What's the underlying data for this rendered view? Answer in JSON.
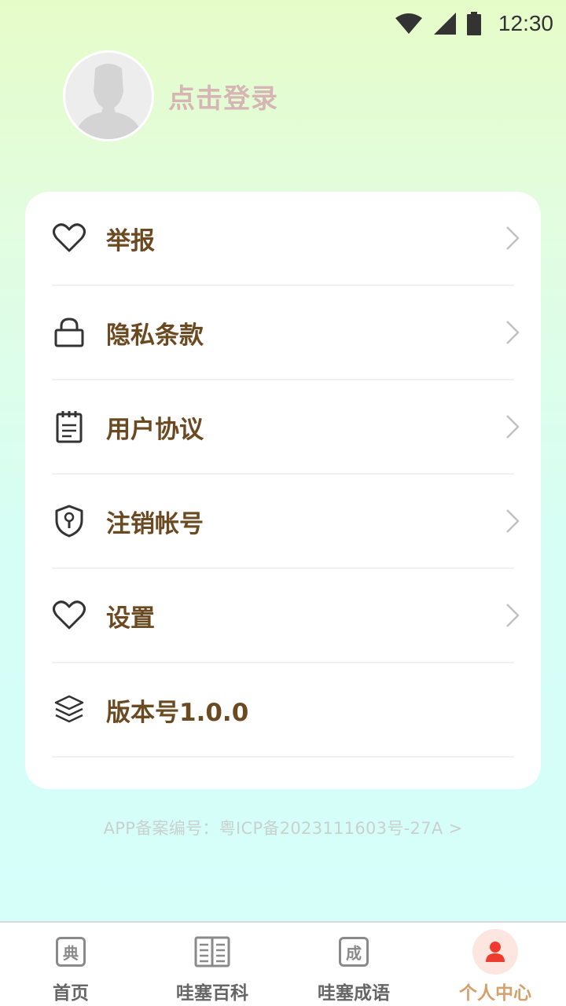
{
  "status_bar": {
    "time": "12:30"
  },
  "profile": {
    "login_label": "点击登录"
  },
  "menu": {
    "items": [
      {
        "label": "举报",
        "icon": "heart-icon",
        "has_chevron": true
      },
      {
        "label": "隐私条款",
        "icon": "lock-icon",
        "has_chevron": true
      },
      {
        "label": "用户协议",
        "icon": "notepad-icon",
        "has_chevron": true
      },
      {
        "label": "注销帐号",
        "icon": "shield-key-icon",
        "has_chevron": true
      },
      {
        "label": "设置",
        "icon": "heart-icon",
        "has_chevron": true
      },
      {
        "label": "版本号1.0.0",
        "icon": "layers-icon",
        "has_chevron": false
      }
    ]
  },
  "icp": {
    "text": "APP备案编号：粤ICP备2023111603号-27A >"
  },
  "tabbar": {
    "tabs": [
      {
        "label": "首页",
        "glyph": "典",
        "active": false
      },
      {
        "label": "哇塞百科",
        "icon": "book-icon",
        "active": false
      },
      {
        "label": "哇塞成语",
        "glyph": "成",
        "active": false
      },
      {
        "label": "个人中心",
        "icon": "person-icon",
        "active": true
      }
    ]
  },
  "colors": {
    "accent_text": "#6b4a22",
    "active_tab": "#d6a06a",
    "active_icon": "#ef3a2e",
    "login_text": "#d6b5b5"
  }
}
